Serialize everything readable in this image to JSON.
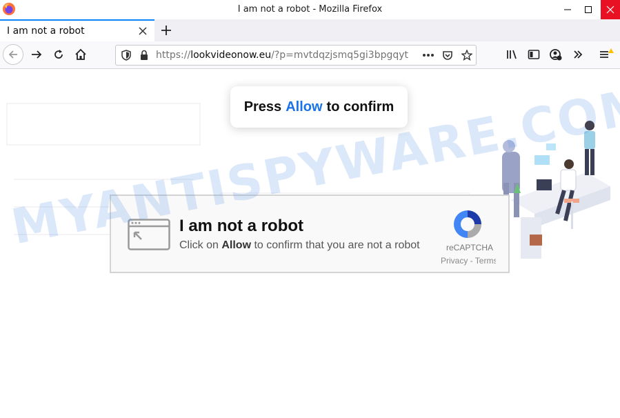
{
  "window": {
    "title": "I am not a robot - Mozilla Firefox"
  },
  "tab": {
    "title": "I am not a robot"
  },
  "navbar": {
    "url_scheme": "https://",
    "url_host": "lookvideonow.eu",
    "url_path": "/?p=mvtdqzjsmq5gi3bpgqyt",
    "icons": [
      "back-arrow-icon",
      "forward-arrow-icon",
      "reload-icon",
      "home-icon",
      "shield-icon",
      "lock-icon",
      "more-icon",
      "pocket-icon",
      "star-icon",
      "library-icon",
      "sidebar-icon",
      "account-icon",
      "overflow-icon",
      "menu-icon"
    ]
  },
  "prompt": {
    "press": "Press",
    "allow": "Allow",
    "confirm": "to confirm"
  },
  "captcha": {
    "title": "I am not a robot",
    "sub_prefix": "Click on",
    "sub_allow": "Allow",
    "sub_suffix": "to confirm that you are not a robot",
    "brand": "reCAPTCHA",
    "links": "Privacy - Terms"
  },
  "watermark": "MYANTISPYWARE.COM",
  "colors": {
    "accent": "#0a84ff",
    "allow_blue": "#1a73e8",
    "close_red": "#e81123"
  }
}
